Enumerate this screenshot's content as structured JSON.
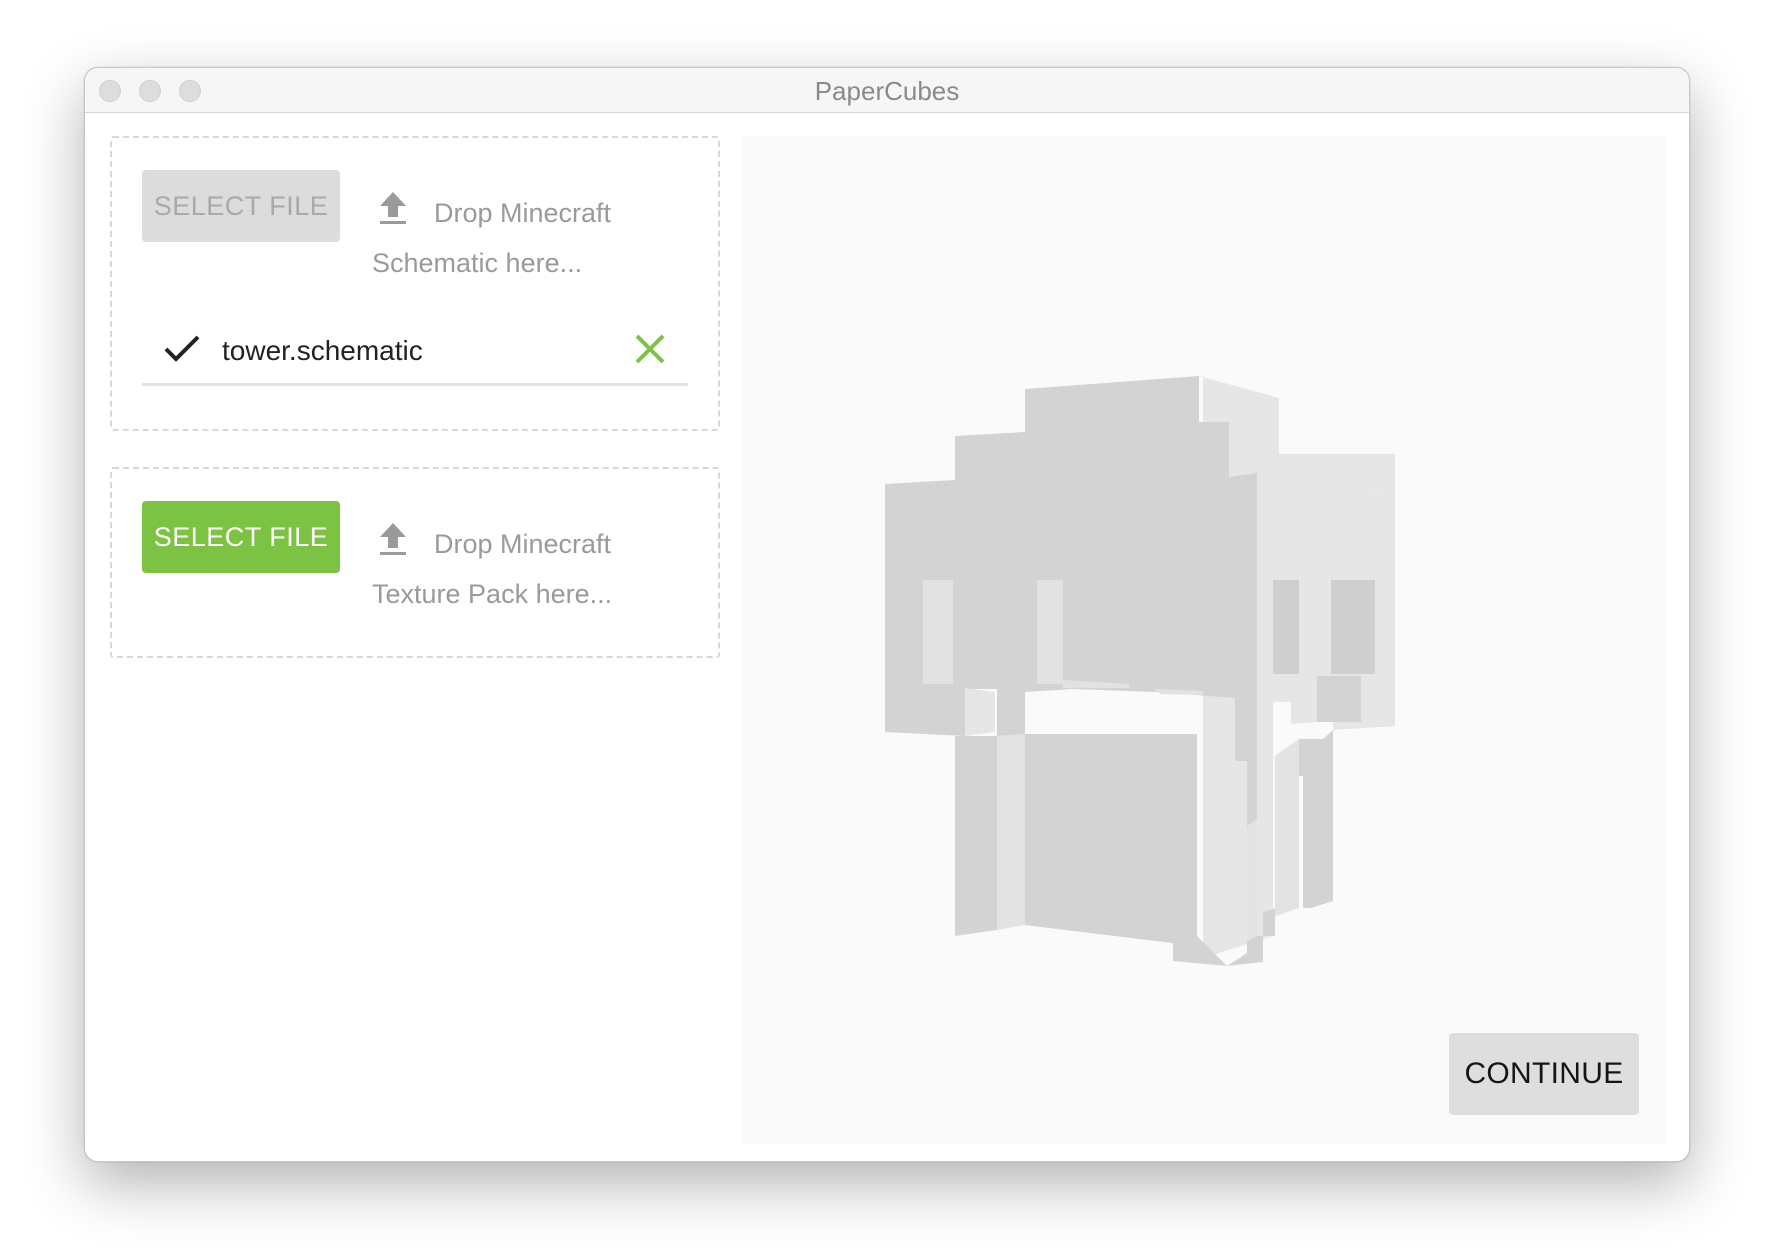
{
  "window": {
    "title": "PaperCubes"
  },
  "schematic_zone": {
    "button_label": "SELECT FILE",
    "button_state": "disabled",
    "drop_line1": "Drop Minecraft",
    "drop_line2": "Schematic here...",
    "upload_icon": "upload-icon",
    "selected_file": {
      "status_icon": "check-icon",
      "name": "tower.schematic",
      "remove_icon": "close-icon",
      "remove_color": "#7cc243"
    }
  },
  "texture_zone": {
    "button_label": "SELECT FILE",
    "button_state": "enabled",
    "drop_line1": "Drop Minecraft",
    "drop_line2": "Texture Pack here...",
    "upload_icon": "upload-icon"
  },
  "preview": {
    "content": "3d-voxel-model-preview",
    "continue_label": "CONTINUE"
  },
  "colors": {
    "accent": "#7cc243",
    "disabled_button": "#dcdcdc",
    "muted_text": "#9a9a9a",
    "preview_bg": "#fafafa"
  }
}
